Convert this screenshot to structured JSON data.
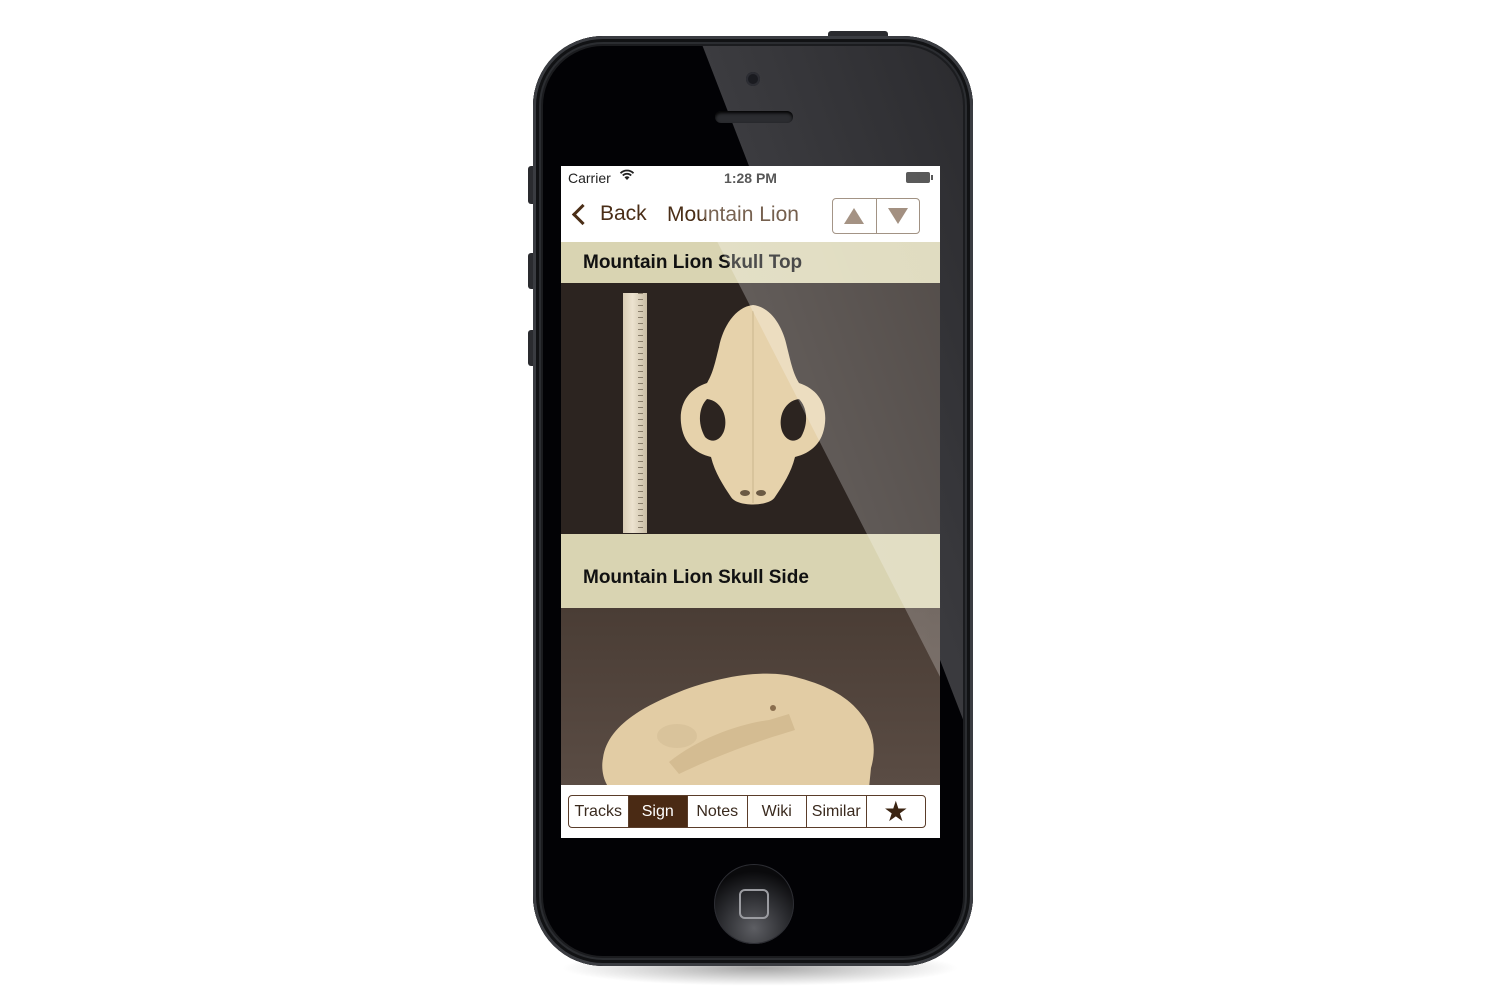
{
  "device": {
    "type": "iPhone"
  },
  "status_bar": {
    "carrier": "Carrier",
    "wifi_icon": "wifi-icon",
    "time": "1:28 PM",
    "battery_icon": "battery-icon"
  },
  "nav_bar": {
    "back_label": "Back",
    "title": "Mountain Lion",
    "prev_icon": "triangle-up-icon",
    "next_icon": "triangle-down-icon"
  },
  "sections": [
    {
      "title": "Mountain Lion Skull Top",
      "image": "skull-top-photo"
    },
    {
      "title": "Mountain Lion Skull Side",
      "image": "skull-side-photo"
    }
  ],
  "tab_bar": {
    "items": [
      {
        "label": "Tracks",
        "active": false
      },
      {
        "label": "Sign",
        "active": true
      },
      {
        "label": "Notes",
        "active": false
      },
      {
        "label": "Wiki",
        "active": false
      },
      {
        "label": "Similar",
        "active": false
      },
      {
        "label": "★",
        "icon": "star-icon",
        "active": false
      }
    ]
  },
  "colors": {
    "accent_brown": "#4a2a14",
    "section_header_bg": "#d9d4b2",
    "nav_text": "#4a2e17"
  }
}
